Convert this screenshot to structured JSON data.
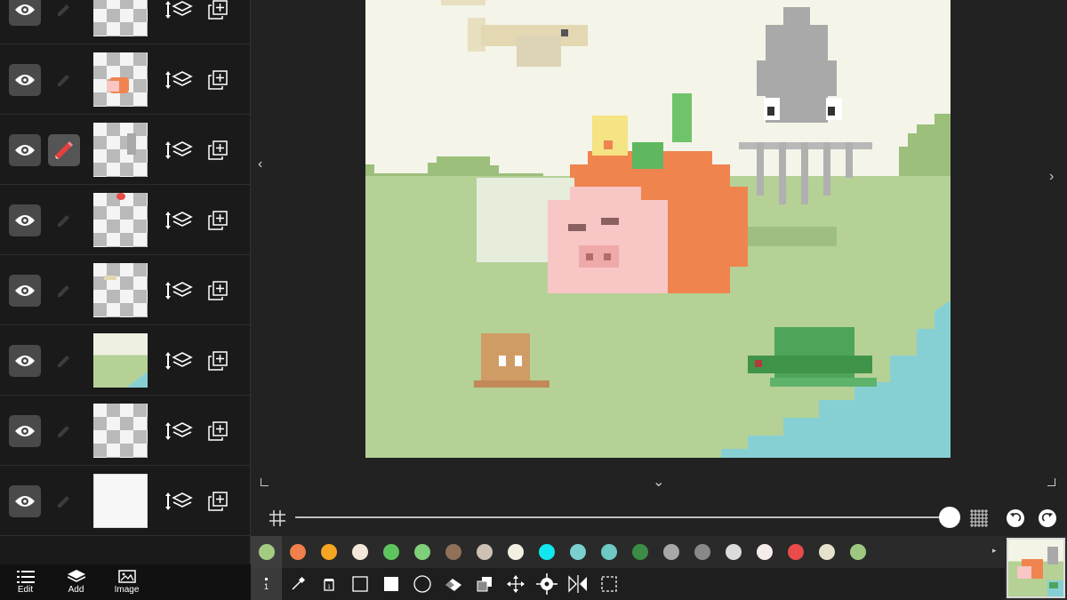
{
  "layers": [
    {
      "visible": true,
      "active": false,
      "thumb": "empty",
      "eye_icon": "eye-icon",
      "pen_icon": "pencil-icon"
    },
    {
      "visible": true,
      "active": false,
      "thumb": "pig-orange",
      "eye_icon": "eye-icon",
      "pen_icon": "pencil-icon"
    },
    {
      "visible": true,
      "active": true,
      "thumb": "squid",
      "eye_icon": "eye-icon",
      "pen_icon": "pencil-icon"
    },
    {
      "visible": true,
      "active": false,
      "thumb": "red-dot",
      "eye_icon": "eye-icon",
      "pen_icon": "pencil-icon"
    },
    {
      "visible": true,
      "active": false,
      "thumb": "fish",
      "eye_icon": "eye-icon",
      "pen_icon": "pencil-icon"
    },
    {
      "visible": true,
      "active": false,
      "thumb": "landscape",
      "eye_icon": "eye-icon",
      "pen_icon": "pencil-icon"
    },
    {
      "visible": true,
      "active": false,
      "thumb": "empty",
      "eye_icon": "eye-icon",
      "pen_icon": "pencil-icon"
    },
    {
      "visible": true,
      "active": false,
      "thumb": "background",
      "eye_icon": "eye-icon",
      "pen_icon": "pencil-icon"
    }
  ],
  "left_nav": [
    {
      "label": "Edit",
      "icon": "list-icon"
    },
    {
      "label": "Add",
      "icon": "add-layer-icon"
    },
    {
      "label": "Image",
      "icon": "image-icon"
    }
  ],
  "slider": {
    "value_fraction": 0.995
  },
  "palette": {
    "selected_index": 0,
    "colors": [
      "#a3cb84",
      "#ef7f4c",
      "#f5a623",
      "#f3e7da",
      "#5fc35f",
      "#7ed07a",
      "#8f7157",
      "#cdc1b4",
      "#f2f0e2",
      "#12e7ee",
      "#7ccfcf",
      "#6ec8c3",
      "#3b8d45",
      "#a8a8a8",
      "#888888",
      "#dcdcdc",
      "#f6ecec",
      "#ea4b4b",
      "#e6e0cc",
      "#9ec881"
    ]
  },
  "tools": {
    "brush_size": "1",
    "items": [
      "brush-size-icon",
      "eyedropper-icon",
      "bucket-fill-icon",
      "rectangle-outline-icon",
      "rectangle-filled-icon",
      "circle-icon",
      "eraser-icon",
      "layer-fill-icon",
      "move-icon",
      "crosshair-icon",
      "flip-horizontal-icon",
      "selection-icon"
    ]
  },
  "colors": {
    "canvas_bg": "#f4f4e8",
    "grass": "#b5d196",
    "water": "#86d0d4",
    "accent_active": "#e64040"
  }
}
